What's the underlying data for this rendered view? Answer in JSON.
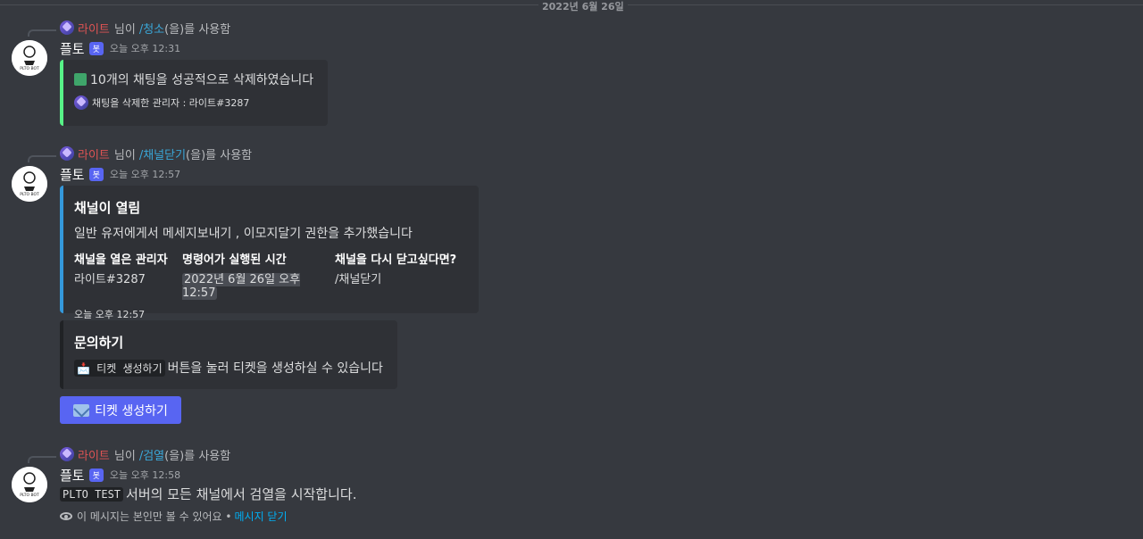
{
  "date_divider": "2022년 6월 26일",
  "messages": [
    {
      "reply": {
        "user": "라이트",
        "mid": "님이",
        "command": "/청소",
        "suffix": "(을)를 사용함"
      },
      "author": "플토",
      "badge": "봇",
      "timestamp": "오늘 오후 12:31",
      "embed": {
        "text": "10개의 채팅을 성공적으로 삭제하였습니다",
        "footer": "채팅을 삭제한 관리자 : 라이트#3287"
      }
    },
    {
      "reply": {
        "user": "라이트",
        "mid": "님이",
        "command": "/채널닫기",
        "suffix": "(을)를 사용함"
      },
      "author": "플토",
      "badge": "봇",
      "timestamp": "오늘 오후 12:57",
      "embed": {
        "title": "채널이 열림",
        "description": "일반 유저에게서 메세지보내기 , 이모지달기 권한을 추가했습니다",
        "fields": [
          {
            "name": "채널을 열은 관리자",
            "value": "라이트#3287"
          },
          {
            "name": "명령어가 실행된 시간",
            "value": "2022년 6월 26일 오후 12:57"
          },
          {
            "name": "채널을 다시 닫고싶다면?",
            "value": "/채널닫기"
          }
        ],
        "footer": "오늘 오후 12:57"
      },
      "embed2": {
        "title": "문의하기",
        "code": "📩 티켓 생성하기",
        "text": "버튼을 눌러 티켓을 생성하실 수 있습니다"
      },
      "button": "티켓 생성하기"
    },
    {
      "reply": {
        "user": "라이트",
        "mid": "님이",
        "command": "/검열",
        "suffix": "(을)를 사용함"
      },
      "author": "플토",
      "badge": "봇",
      "timestamp": "오늘 오후 12:58",
      "code": "PLTO TEST",
      "text": "서버의 모든 채널에서 검열을 시작합니다.",
      "ephemeral": {
        "text": "이 메시지는 본인만 볼 수 있어요 •",
        "link": "메시지 닫기"
      }
    }
  ],
  "avatar_text": {
    "line1": "PLTO BOT"
  }
}
